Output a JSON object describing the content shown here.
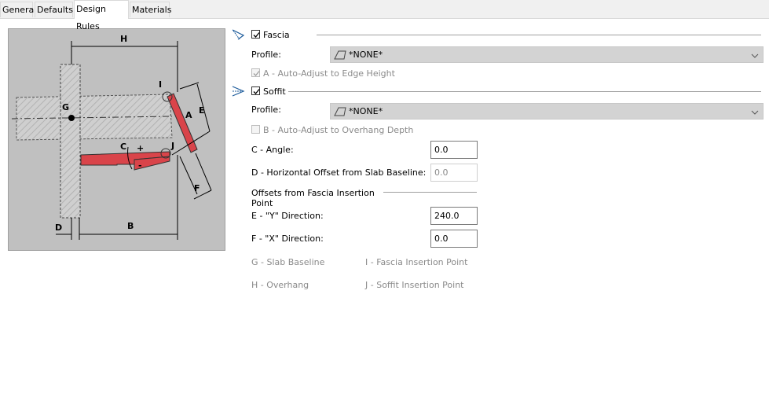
{
  "tabs": [
    {
      "label": "General"
    },
    {
      "label": "Defaults"
    },
    {
      "label": "Design Rules"
    },
    {
      "label": "Materials"
    }
  ],
  "diagram": {
    "labels": {
      "h": "H",
      "i": "I",
      "g": "G",
      "e": "E",
      "a": "A",
      "c": "C",
      "plus": "+",
      "minus": "-",
      "j": "J",
      "f": "F",
      "d": "D",
      "b": "B"
    }
  },
  "fascia": {
    "label": "Fascia",
    "checked": true,
    "profile_label": "Profile:",
    "profile_value": "*NONE*",
    "auto_adjust_label": "A - Auto-Adjust to Edge Height",
    "auto_adjust_checked": true
  },
  "soffit": {
    "label": "Soffit",
    "checked": true,
    "profile_label": "Profile:",
    "profile_value": "*NONE*",
    "auto_adjust_label": "B - Auto-Adjust to Overhang Depth",
    "auto_adjust_checked": false
  },
  "angle": {
    "label": "C - Angle:",
    "value": "0.0"
  },
  "h_offset": {
    "label": "D - Horizontal Offset from Slab Baseline:",
    "value": "0.0"
  },
  "offsets": {
    "heading_line1": "Offsets from Fascia Insertion",
    "heading_line2": "Point",
    "y_label": "E - \"Y\" Direction:",
    "y_value": "240.0",
    "x_label": "F - \"X\" Direction:",
    "x_value": "0.0"
  },
  "legend": {
    "g": "G - Slab Baseline",
    "i": "I - Fascia Insertion Point",
    "h": "H - Overhang",
    "j": "J - Soffit Insertion Point"
  }
}
